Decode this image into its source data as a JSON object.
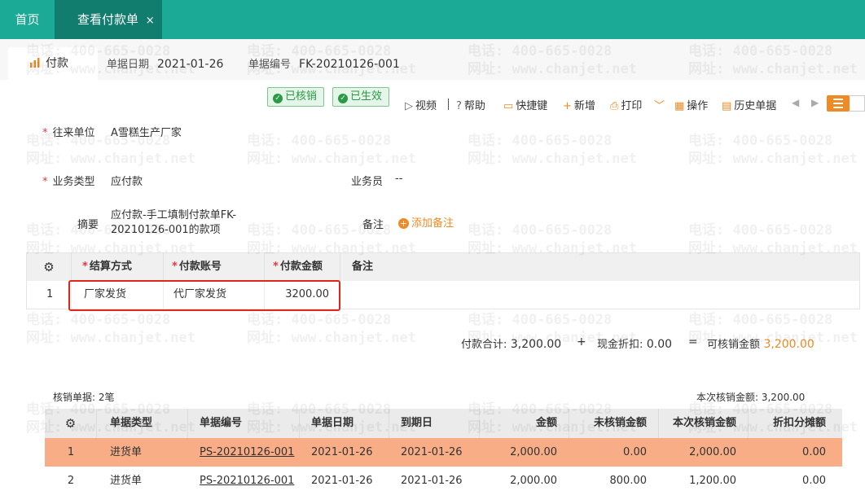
{
  "tabs": {
    "home": "首页",
    "active": "查看付款单",
    "close": "×"
  },
  "doc": {
    "tab_label": "付款",
    "date_label": "单据日期",
    "date": "2021-01-26",
    "number_label": "单据编号",
    "number": "FK-20210126-001"
  },
  "badges": {
    "verified": "已核销",
    "effective": "已生效"
  },
  "toolbar": {
    "video": "视频",
    "help": "帮助",
    "shortcut": "快捷键",
    "add": "新增",
    "print": "打印",
    "operate": "操作",
    "history": "历史单据"
  },
  "form": {
    "partner_label": "往来单位",
    "partner": "A雪糕生产厂家",
    "biz_type_label": "业务类型",
    "biz_type": "应付款",
    "staff_label": "业务员",
    "staff": "--",
    "summary_label": "摘要",
    "summary_line1": "应付款-手工填制付款单FK-",
    "summary_line2": "20210126-001的款项",
    "remark_label": "备注",
    "add_remark": "添加备注"
  },
  "pay_table": {
    "headers": [
      "结算方式",
      "付款账号",
      "付款金额",
      "备注"
    ],
    "rows": [
      {
        "no": "1",
        "method": "厂家发货",
        "account": "代厂家发货",
        "amount": "3200.00",
        "remark": ""
      }
    ]
  },
  "totals": {
    "pay_total_label": "付款合计:",
    "pay_total": "3,200.00",
    "plus": "+",
    "discount_label": "现金折扣:",
    "discount": "0.00",
    "eq": "=",
    "verifiable_label": "可核销金额",
    "verifiable": "3,200.00"
  },
  "verify": {
    "count_label": "核销单据: 2笔",
    "this_amount_label": "本次核销金额: 3,200.00",
    "headers": [
      "单据类型",
      "单据编号",
      "单据日期",
      "到期日",
      "金额",
      "未核销金额",
      "本次核销金额",
      "折扣分摊额"
    ],
    "rows": [
      {
        "no": "1",
        "type": "进货单",
        "number": "PS-20210126-001",
        "date": "2021-01-26",
        "due": "2021-01-26",
        "amount": "2,000.00",
        "unverified": "0.00",
        "this": "2,000.00",
        "discount": "0.00"
      },
      {
        "no": "2",
        "type": "进货单",
        "number": "PS-20210126-001",
        "date": "2021-01-26",
        "due": "2021-01-26",
        "amount": "2,000.00",
        "unverified": "800.00",
        "this": "1,200.00",
        "discount": "0.00"
      }
    ]
  },
  "watermark": {
    "phone": "电话: 400-665-0028",
    "site": "网址: www.chanjet.net"
  },
  "colors": {
    "topbar": "#1aaa96",
    "active_tab": "#117d6e",
    "accent": "#f08a24",
    "selected_row": "#f8ad86",
    "required": "#e4393c",
    "highlight": "#e1251b"
  }
}
